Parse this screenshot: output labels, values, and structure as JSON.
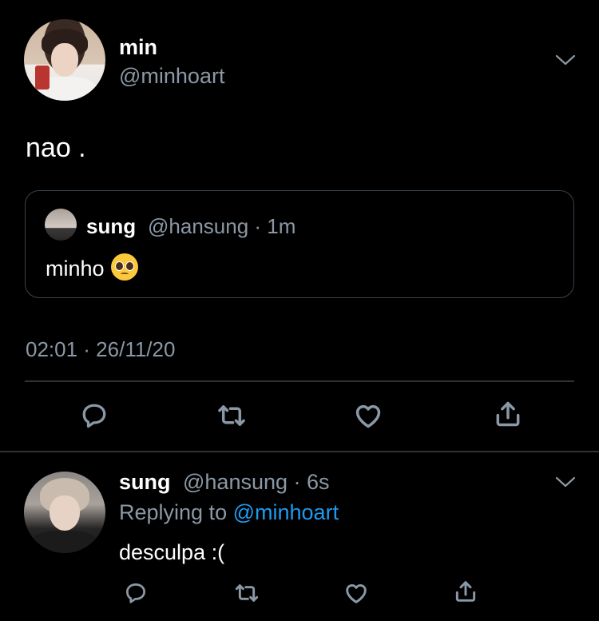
{
  "main_tweet": {
    "display_name": "min",
    "handle": "@minhoart",
    "text": "nao .",
    "quote": {
      "display_name": "sung",
      "meta": "@hansung · 1m",
      "text": "minho"
    },
    "timestamp": "02:01 · 26/11/20"
  },
  "reply_tweet": {
    "display_name": "sung",
    "meta": "@hansung · 6s",
    "replying_prefix": "Replying to",
    "replying_mention": "@minhoart",
    "text": "desculpa :("
  },
  "icons": {
    "reply": "reply-icon",
    "retweet": "retweet-icon",
    "like": "heart-icon",
    "share": "share-icon",
    "more": "chevron-down-icon"
  },
  "colors": {
    "background": "#000000",
    "text": "#ffffff",
    "secondary": "#8b98a5",
    "accent": "#1d9bf0",
    "border": "#38444d"
  }
}
